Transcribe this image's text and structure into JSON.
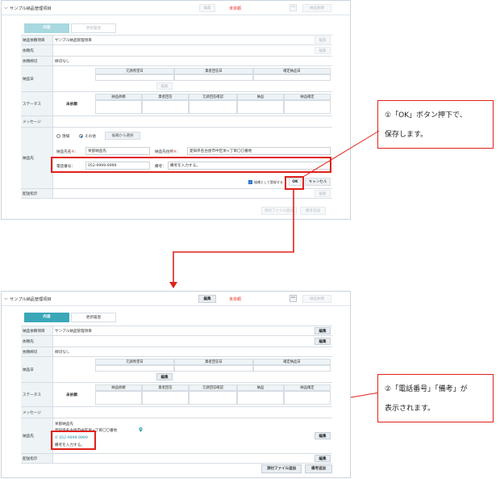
{
  "top": {
    "title": "サンプル納品管理項目",
    "header_edit": "編集",
    "header_status": "未依頼",
    "header_request": "納品依頼",
    "tabs": [
      "内容",
      "更新履歴"
    ],
    "rows": {
      "item_label": "納品依頼項目",
      "item_value": "サンプル納品管理項目",
      "item_edit": "編集",
      "requester_label": "依頼先",
      "requester_edit": "編集",
      "deadline_label": "依頼締切",
      "deadline_value": "締切なし",
      "delivery_date_label": "納品日",
      "delivery_date_cols": [
        "元請希望日",
        "業者回答日",
        "確定納品日"
      ],
      "delivery_date_edit": "編集",
      "status_label": "ステータス",
      "status_value": "未依頼",
      "status_cols": [
        "納品依頼",
        "業者回答",
        "元請回答確認",
        "納品",
        "納品確定"
      ],
      "message_label": "メッセージ",
      "dest_label": "納品先",
      "radio_site": "現場",
      "radio_other": "その他",
      "select_candidate_button": "候補から選択",
      "dest_name_label": "納品先名",
      "dest_name_value": "栄部納品先",
      "dest_address_label": "納品先住所",
      "dest_address_value": "愛知県名古屋市中区栄×丁目〇〇番地",
      "phone_label": "電話番号：",
      "phone_value": "052-9999-9999",
      "note_label": "備考：",
      "note_value": "備考を入力する。",
      "register_candidate_label": "候補として登録する",
      "ok_button": "OK",
      "cancel_button": "キャンセル",
      "delivery_instruction_label": "配送指示",
      "delivery_instruction_edit": "編集",
      "attach_button": "添付ファイル追加",
      "note_add_button": "備考追加"
    }
  },
  "bottom": {
    "title": "サンプル納品管理項目",
    "header_edit": "編集",
    "header_status": "未依頼",
    "header_request": "納品依頼",
    "tabs": [
      "内容",
      "更新履歴"
    ],
    "rows": {
      "item_label": "納品依頼項目",
      "item_value": "サンプル納品管理項目",
      "item_edit": "編集",
      "requester_label": "依頼先",
      "requester_edit": "編集",
      "deadline_label": "依頼締切",
      "deadline_value": "締切なし",
      "delivery_date_label": "納品日",
      "delivery_date_cols": [
        "元請希望日",
        "業者回答日",
        "確定納品日"
      ],
      "delivery_date_edit": "編集",
      "status_label": "ステータス",
      "status_value": "未依頼",
      "status_cols": [
        "納品依頼",
        "業者回答",
        "元請回答確認",
        "納品",
        "納品確定"
      ],
      "message_label": "メッセージ",
      "dest_label": "納品先",
      "dest_name_value": "栄部納品先",
      "dest_address_value": "愛知県名古屋市中区栄×丁目〇〇番地",
      "phone_value": "052-9999-9999",
      "note_value": "備考を入力する。",
      "dest_edit": "編集",
      "delivery_instruction_label": "配送指示",
      "delivery_instruction_edit": "編集",
      "attach_button": "添付ファイル追加",
      "note_add_button": "備考追加"
    }
  },
  "callouts": {
    "first": [
      "①「OK」ボタン押下で、",
      "保存します。"
    ],
    "second": [
      "②「電話番号」「備考」が",
      "表示されます。"
    ]
  },
  "colors": {
    "accent": "#3aa7b8",
    "annotation": "#e0221b",
    "status": "#e5352b"
  }
}
